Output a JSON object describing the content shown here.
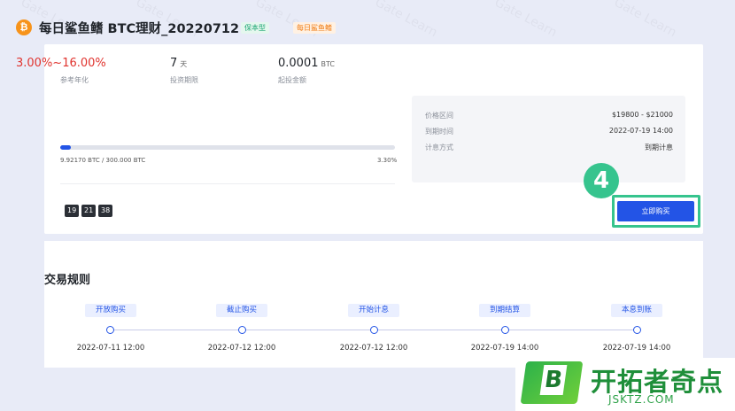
{
  "watermark": "Gate Learn",
  "product": {
    "coin_symbol": "₿",
    "title": "每日鲨鱼鳍 BTC理财_20220712",
    "badges": [
      "保本型",
      "每日鲨鱼鳍"
    ]
  },
  "stats": [
    {
      "value": "3.00%~16.00%",
      "unit": "",
      "label": "参考年化"
    },
    {
      "value": "7",
      "unit": "天",
      "label": "投资期限"
    },
    {
      "value": "0.0001",
      "unit": "BTC",
      "label": "起投金额"
    }
  ],
  "progress": {
    "fraction": 0.033,
    "left_text": "9.92170 BTC / 300.000 BTC",
    "right_text": "3.30%"
  },
  "countdown": [
    "19",
    "21",
    "38"
  ],
  "info": [
    {
      "label": "价格区间",
      "value": "$19800 - $21000"
    },
    {
      "label": "到期时间",
      "value": "2022-07-19 14:00"
    },
    {
      "label": "计息方式",
      "value": "到期计息"
    }
  ],
  "step_number": "4",
  "buy_button": "立即购买",
  "rules": {
    "title": "交易规则",
    "steps": [
      {
        "label": "开放购买",
        "date": "2022-07-11 12:00"
      },
      {
        "label": "截止购买",
        "date": "2022-07-12 12:00"
      },
      {
        "label": "开始计息",
        "date": "2022-07-12 12:00"
      },
      {
        "label": "到期结算",
        "date": "2022-07-19 14:00"
      },
      {
        "label": "本息到账",
        "date": "2022-07-19 14:00"
      }
    ]
  },
  "site_logo": {
    "mark_letter": "B",
    "name": "开拓者奇点",
    "url": "JSKTZ.COM"
  }
}
